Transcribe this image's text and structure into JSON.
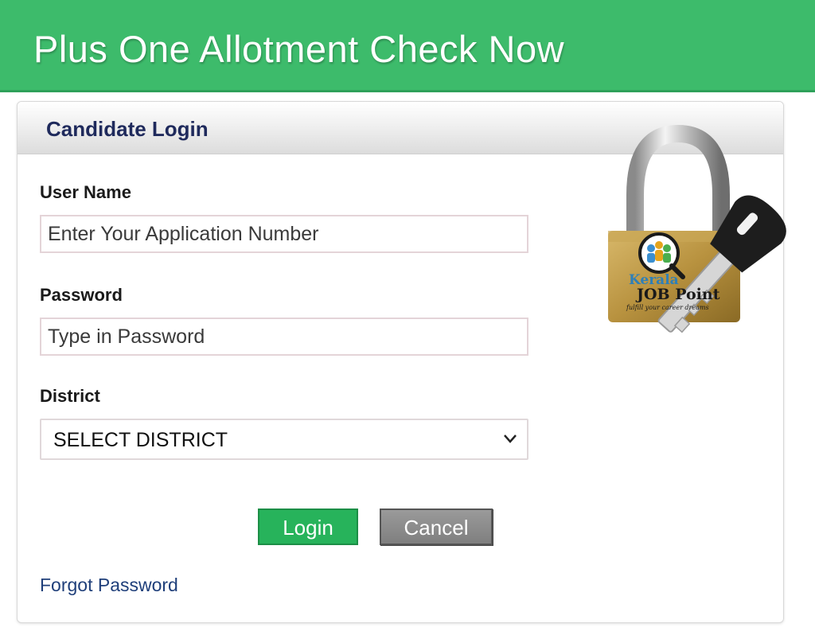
{
  "banner": {
    "title": "Plus One Allotment Check Now"
  },
  "login": {
    "header": "Candidate Login",
    "username_label": "User Name",
    "username_placeholder": "Enter Your Application Number",
    "password_label": "Password",
    "password_placeholder": "Type in Password",
    "district_label": "District",
    "district_selected": "SELECT DISTRICT",
    "login_button": "Login",
    "cancel_button": "Cancel",
    "forgot_link": "Forgot Password"
  },
  "logo": {
    "icon": "padlock-key-icon",
    "line1": "Kerala",
    "line2": "JOB Point",
    "tagline": "fulfill your career dreams"
  },
  "colors": {
    "banner": "#3dbb6b",
    "login_button": "#27b35b",
    "cancel_button": "#888888",
    "header_text": "#1f2a5c",
    "link": "#1f3f7a"
  }
}
